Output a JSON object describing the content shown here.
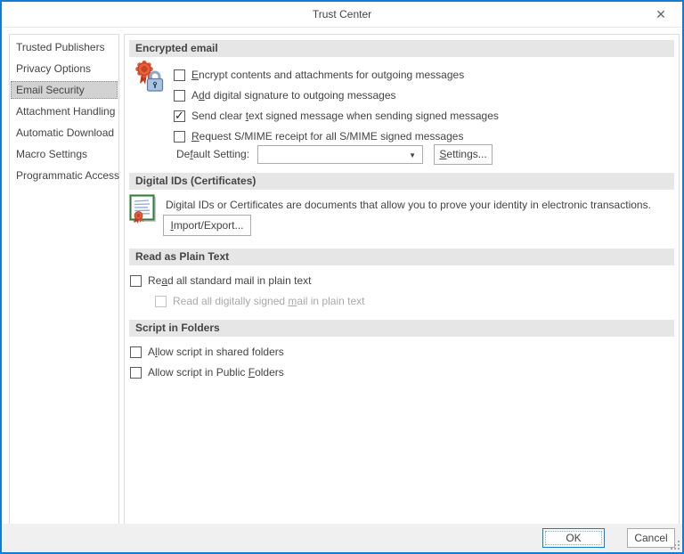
{
  "window": {
    "title": "Trust Center",
    "close_glyph": "✕"
  },
  "sidebar": {
    "items": [
      {
        "label": "Trusted Publishers",
        "selected": false
      },
      {
        "label": "Privacy Options",
        "selected": false
      },
      {
        "label": "Email Security",
        "selected": true
      },
      {
        "label": "Attachment Handling",
        "selected": false
      },
      {
        "label": "Automatic Download",
        "selected": false
      },
      {
        "label": "Macro Settings",
        "selected": false
      },
      {
        "label": "Programmatic Access",
        "selected": false
      }
    ]
  },
  "sections": {
    "encrypted_email": {
      "header": "Encrypted email",
      "checkboxes": [
        {
          "pre": "",
          "key": "E",
          "post": "ncrypt contents and attachments for outgoing messages",
          "checked": false,
          "enabled": true
        },
        {
          "pre": "A",
          "key": "d",
          "post": "d digital signature to outgoing messages",
          "checked": false,
          "enabled": true
        },
        {
          "pre": "Send clear ",
          "key": "t",
          "post": "ext signed message when sending signed messages",
          "checked": true,
          "enabled": true
        },
        {
          "pre": "",
          "key": "R",
          "post": "equest S/MIME receipt for all S/MIME signed messages",
          "checked": false,
          "enabled": true
        }
      ],
      "default_setting": {
        "label_pre": "De",
        "label_key": "f",
        "label_post": "ault Setting:",
        "combo_value": "",
        "settings_pre": "",
        "settings_key": "S",
        "settings_post": "ettings..."
      }
    },
    "digital_ids": {
      "header": "Digital IDs (Certificates)",
      "description": "Digital IDs or Certificates are documents that allow you to prove your identity in electronic transactions.",
      "import_pre": "",
      "import_key": "I",
      "import_post": "mport/Export..."
    },
    "read_plain": {
      "header": "Read as Plain Text",
      "checkboxes": [
        {
          "pre": "Re",
          "key": "a",
          "post": "d all standard mail in plain text",
          "checked": false,
          "enabled": true
        },
        {
          "pre": "Read all digitally signed ",
          "key": "m",
          "post": "ail in plain text",
          "checked": false,
          "enabled": false
        }
      ]
    },
    "script_folders": {
      "header": "Script in Folders",
      "checkboxes": [
        {
          "pre": "A",
          "key": "l",
          "post": "low script in shared folders",
          "checked": false,
          "enabled": true
        },
        {
          "pre": "Allow script in Public ",
          "key": "F",
          "post": "olders",
          "checked": false,
          "enabled": true
        }
      ]
    }
  },
  "footer": {
    "ok_label": "OK",
    "cancel_label": "Cancel"
  }
}
